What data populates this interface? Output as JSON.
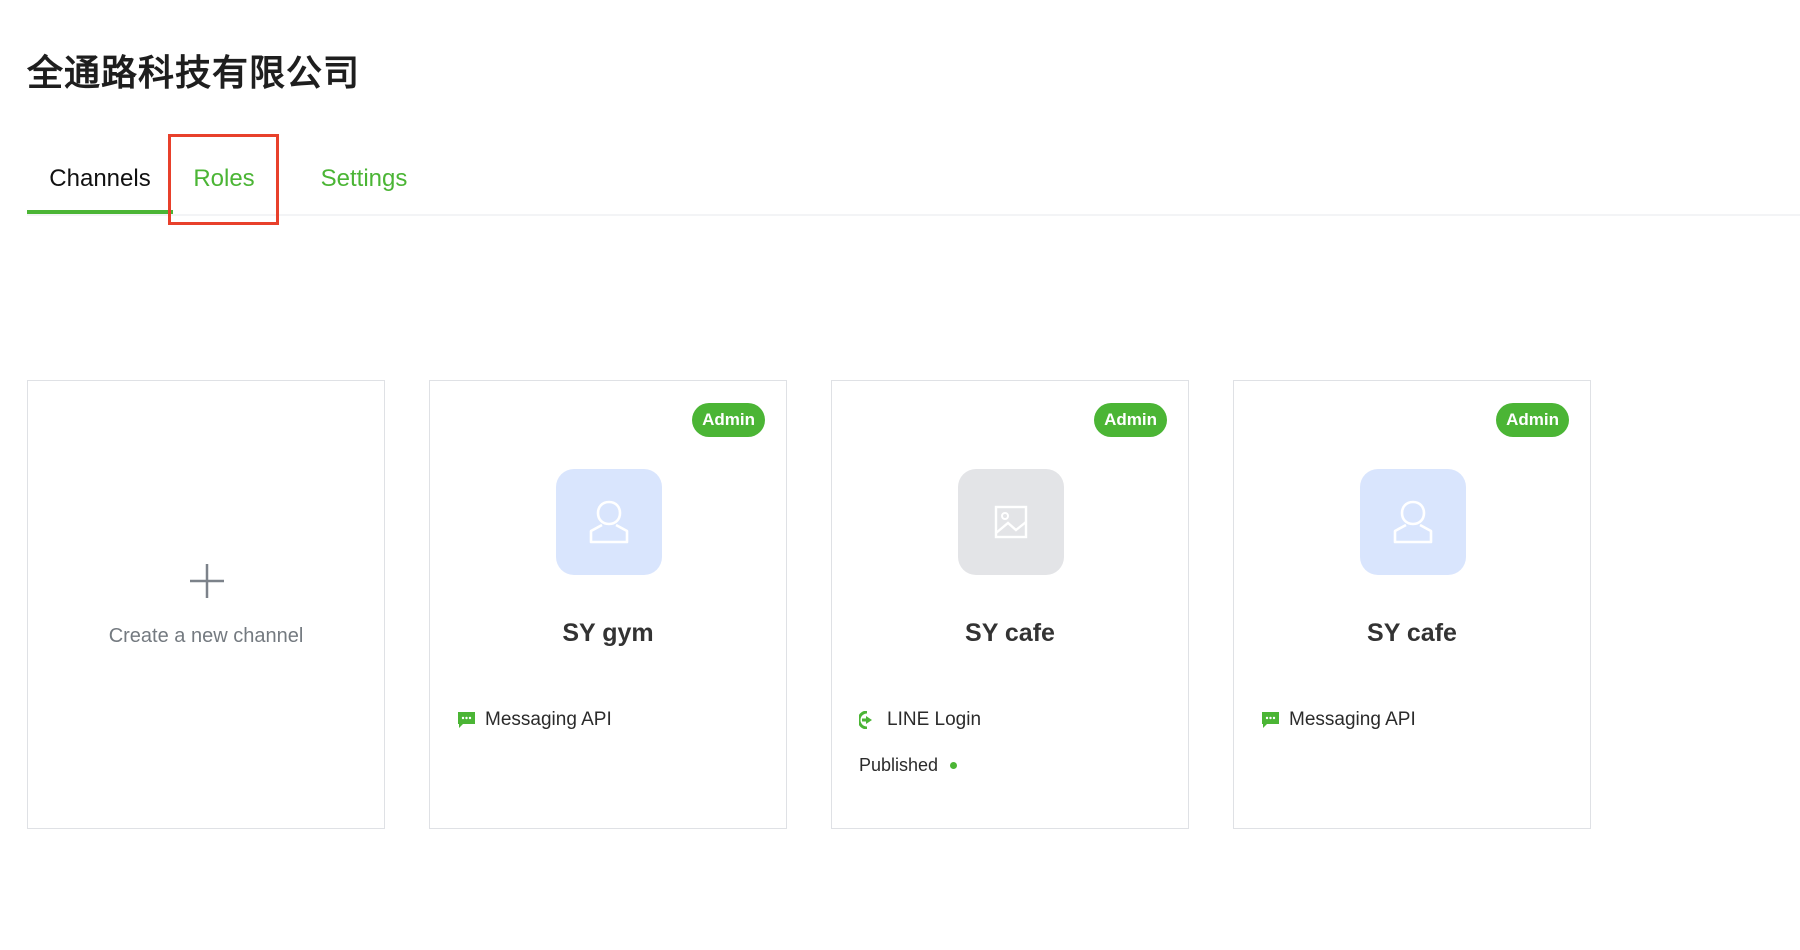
{
  "provider": {
    "title": "全通路科技有限公司"
  },
  "tabs": [
    {
      "label": "Channels",
      "active": true
    },
    {
      "label": "Roles",
      "active": false
    },
    {
      "label": "Settings",
      "active": false
    }
  ],
  "create_card": {
    "label": "Create a new channel",
    "icon": "plus-icon"
  },
  "channels": [
    {
      "name": "SY gym",
      "role": "Admin",
      "type": "Messaging API",
      "type_icon": "chat-bubble-icon",
      "avatar_icon": "person-icon",
      "status": ""
    },
    {
      "name": "SY cafe",
      "role": "Admin",
      "type": "LINE Login",
      "type_icon": "login-arrow-icon",
      "avatar_icon": "image-icon",
      "status": "Published"
    },
    {
      "name": "SY cafe",
      "role": "Admin",
      "type": "Messaging API",
      "type_icon": "chat-bubble-icon",
      "avatar_icon": "person-icon",
      "status": ""
    }
  ],
  "colors": {
    "accent": "#4bb535",
    "highlight": "#e8402b",
    "avatar_blue": "#d9e5fd",
    "avatar_gray": "#e3e4e7"
  }
}
